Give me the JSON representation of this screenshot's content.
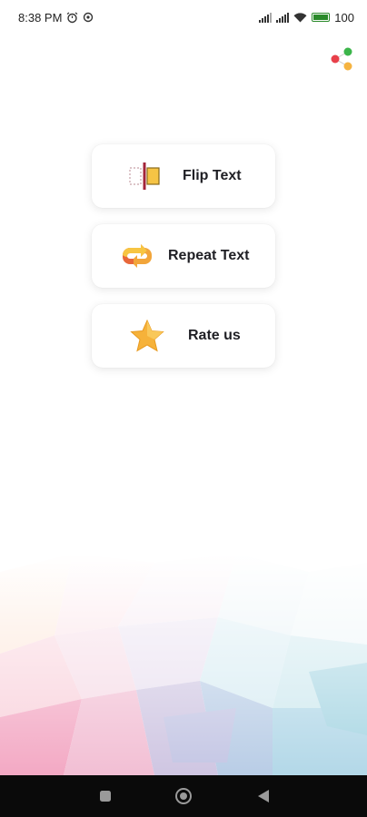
{
  "status_bar": {
    "time": "8:38 PM",
    "battery_text": "100",
    "icons": [
      "alarm-icon",
      "sync-icon",
      "signal-icon",
      "signal-icon",
      "wifi-icon",
      "battery-icon"
    ]
  },
  "header": {
    "share_icon": "share-icon"
  },
  "menu": {
    "items": [
      {
        "label": "Flip Text",
        "icon": "flip-icon"
      },
      {
        "label": "Repeat Text",
        "icon": "repeat-icon"
      },
      {
        "label": "Rate us",
        "icon": "star-icon"
      }
    ]
  },
  "nav": {
    "buttons": [
      "recent-apps-icon",
      "home-icon",
      "back-icon"
    ]
  },
  "colors": {
    "accent_red": "#e8404a",
    "accent_green": "#3bb54a",
    "accent_orange": "#f5b340",
    "star": "#f6b23a",
    "card_text": "#1f1f24",
    "nav_bg": "#0a0a0a"
  }
}
